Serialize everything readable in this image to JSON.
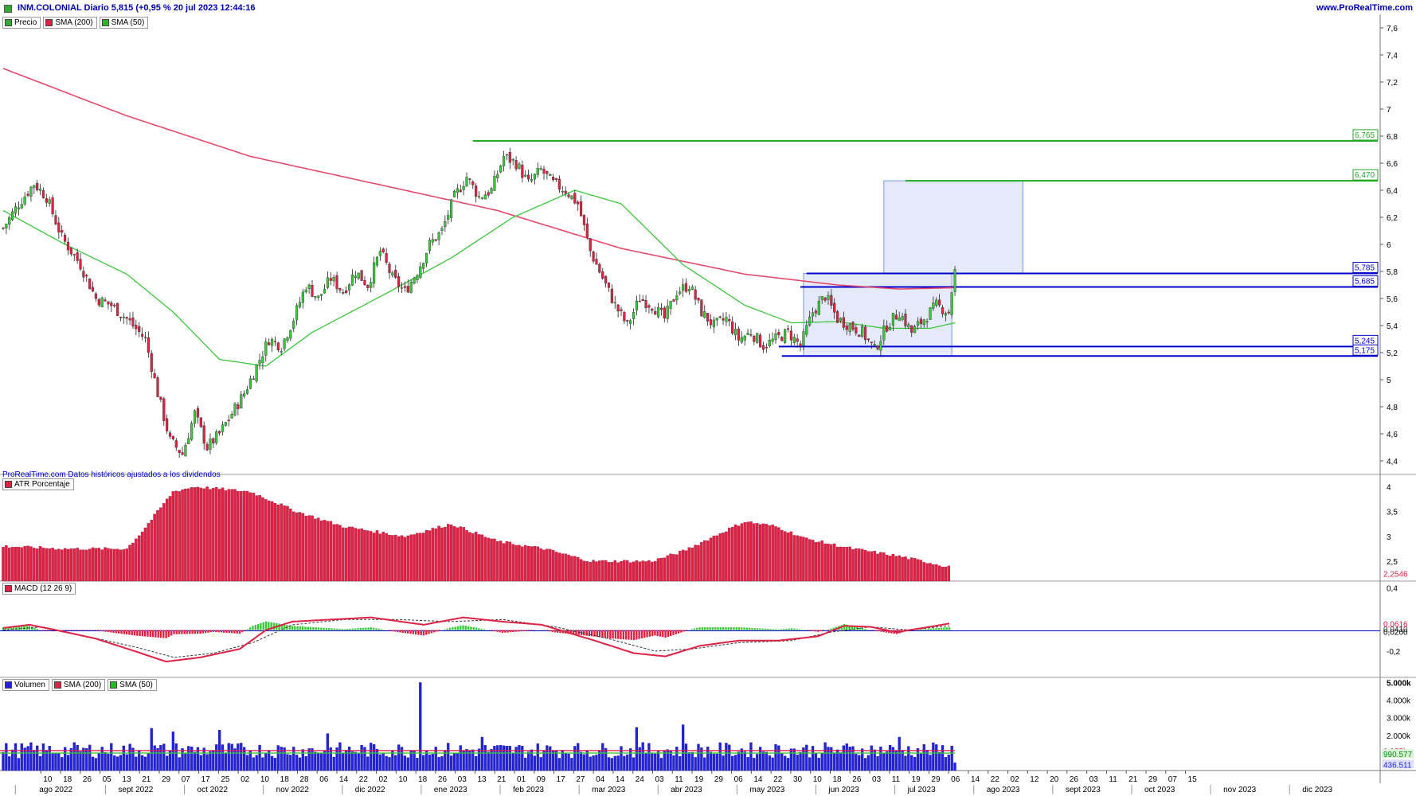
{
  "header": {
    "title": "INM.COLONIAL Diario 5,815 (+0,95 % 20 jul 2023 12:44:16",
    "site": "www.ProRealTime.com"
  },
  "note": "ProRealTime.com Datos históricos ajustados a los dividendos",
  "legends": {
    "price": [
      {
        "label": "Precio",
        "color": "#33aa33"
      },
      {
        "label": "SMA (200)",
        "color": "#dd2244"
      },
      {
        "label": "SMA (50)",
        "color": "#22bb22"
      }
    ],
    "atr": [
      {
        "label": "ATR Porcentaje",
        "color": "#dd2244"
      }
    ],
    "macd": [
      {
        "label": "MACD (12 26 9)",
        "color": "#dd2244"
      }
    ],
    "volume": [
      {
        "label": "Volumen",
        "color": "#2222dd"
      },
      {
        "label": "SMA (200)",
        "color": "#dd2244"
      },
      {
        "label": "SMA (50)",
        "color": "#22bb22"
      }
    ]
  },
  "chart_data": [
    {
      "type": "candlestick",
      "name": "Precio",
      "ylim": [
        4.3,
        7.7
      ],
      "yticks": [
        "7,6",
        "7,4",
        "7,2",
        "7",
        "6,8",
        "6,6",
        "6,4",
        "6,2",
        "6",
        "5,8",
        "5,6",
        "5,4",
        "5,2",
        "5",
        "4,8",
        "4,6",
        "4,4"
      ],
      "ytick_values": [
        7.6,
        7.4,
        7.2,
        7.0,
        6.8,
        6.6,
        6.4,
        6.2,
        6.0,
        5.8,
        5.6,
        5.4,
        5.2,
        5.0,
        4.8,
        4.6,
        4.4
      ],
      "last_close": 5.815,
      "close_anchors": [
        [
          0,
          6.12
        ],
        [
          5,
          6.3
        ],
        [
          10,
          6.45
        ],
        [
          14,
          6.35
        ],
        [
          19,
          6.05
        ],
        [
          25,
          5.85
        ],
        [
          30,
          5.6
        ],
        [
          35,
          5.55
        ],
        [
          40,
          5.45
        ],
        [
          46,
          5.3
        ],
        [
          50,
          4.9
        ],
        [
          54,
          4.55
        ],
        [
          58,
          4.45
        ],
        [
          62,
          4.75
        ],
        [
          66,
          4.5
        ],
        [
          70,
          4.6
        ],
        [
          74,
          4.75
        ],
        [
          78,
          4.9
        ],
        [
          82,
          5.1
        ],
        [
          86,
          5.3
        ],
        [
          90,
          5.25
        ],
        [
          94,
          5.45
        ],
        [
          98,
          5.7
        ],
        [
          102,
          5.6
        ],
        [
          106,
          5.75
        ],
        [
          110,
          5.65
        ],
        [
          114,
          5.8
        ],
        [
          118,
          5.7
        ],
        [
          122,
          5.95
        ],
        [
          126,
          5.75
        ],
        [
          130,
          5.65
        ],
        [
          134,
          5.8
        ],
        [
          138,
          6.0
        ],
        [
          142,
          6.1
        ],
        [
          146,
          6.35
        ],
        [
          150,
          6.5
        ],
        [
          154,
          6.35
        ],
        [
          158,
          6.4
        ],
        [
          162,
          6.65
        ],
        [
          166,
          6.6
        ],
        [
          170,
          6.45
        ],
        [
          174,
          6.55
        ],
        [
          178,
          6.45
        ],
        [
          182,
          6.4
        ],
        [
          186,
          6.3
        ],
        [
          190,
          5.95
        ],
        [
          194,
          5.75
        ],
        [
          198,
          5.55
        ],
        [
          202,
          5.4
        ],
        [
          206,
          5.6
        ],
        [
          210,
          5.55
        ],
        [
          214,
          5.45
        ],
        [
          218,
          5.65
        ],
        [
          222,
          5.7
        ],
        [
          226,
          5.5
        ],
        [
          230,
          5.4
        ],
        [
          234,
          5.45
        ],
        [
          238,
          5.3
        ],
        [
          242,
          5.35
        ],
        [
          246,
          5.25
        ],
        [
          250,
          5.3
        ],
        [
          254,
          5.35
        ],
        [
          258,
          5.25
        ],
        [
          262,
          5.5
        ],
        [
          266,
          5.62
        ],
        [
          270,
          5.45
        ],
        [
          274,
          5.4
        ],
        [
          278,
          5.35
        ],
        [
          282,
          5.22
        ],
        [
          286,
          5.4
        ],
        [
          290,
          5.5
        ],
        [
          294,
          5.35
        ],
        [
          298,
          5.45
        ],
        [
          302,
          5.55
        ],
        [
          306,
          5.5
        ],
        [
          308,
          5.815
        ]
      ],
      "sma200_anchors": [
        [
          0,
          7.3
        ],
        [
          40,
          6.95
        ],
        [
          80,
          6.65
        ],
        [
          120,
          6.45
        ],
        [
          160,
          6.25
        ],
        [
          200,
          5.97
        ],
        [
          240,
          5.78
        ],
        [
          270,
          5.7
        ],
        [
          290,
          5.67
        ],
        [
          308,
          5.68
        ]
      ],
      "sma50_anchors": [
        [
          0,
          6.25
        ],
        [
          20,
          6.0
        ],
        [
          40,
          5.78
        ],
        [
          55,
          5.5
        ],
        [
          70,
          5.15
        ],
        [
          85,
          5.1
        ],
        [
          100,
          5.35
        ],
        [
          125,
          5.65
        ],
        [
          145,
          5.9
        ],
        [
          165,
          6.2
        ],
        [
          185,
          6.4
        ],
        [
          200,
          6.3
        ],
        [
          220,
          5.85
        ],
        [
          240,
          5.55
        ],
        [
          255,
          5.42
        ],
        [
          270,
          5.43
        ],
        [
          285,
          5.38
        ],
        [
          300,
          5.38
        ],
        [
          308,
          5.42
        ]
      ],
      "levels": [
        {
          "label": "6,765",
          "value": 6.765,
          "color": "#22aa22"
        },
        {
          "label": "6,470",
          "value": 6.47,
          "color": "#22aa22"
        },
        {
          "label": "5,785",
          "value": 5.785,
          "color": "#0000cc"
        },
        {
          "label": "5,685",
          "value": 5.685,
          "color": "#0000cc"
        },
        {
          "label": "5,245",
          "value": 5.245,
          "color": "#0000cc"
        },
        {
          "label": "5,175",
          "value": 5.175,
          "color": "#0000cc"
        }
      ],
      "rectangles": [
        {
          "from_bar": 259,
          "to_bar": 307,
          "low": 5.175,
          "high": 5.785
        },
        {
          "from_bar": 285,
          "to_bar": 330,
          "low": 5.785,
          "high": 6.47
        }
      ]
    },
    {
      "type": "bar",
      "name": "ATR Porcentaje",
      "ylim": [
        2.1,
        4.2
      ],
      "yticks": [
        "4",
        "3,5",
        "3",
        "2,5"
      ],
      "ytick_values": [
        4,
        3.5,
        3,
        2.5
      ],
      "last_value_label": "2,2546",
      "last_value": 2.2546,
      "anchors": [
        [
          0,
          2.8
        ],
        [
          20,
          2.75
        ],
        [
          40,
          2.75
        ],
        [
          45,
          3.1
        ],
        [
          55,
          3.9
        ],
        [
          62,
          4.0
        ],
        [
          80,
          3.9
        ],
        [
          95,
          3.5
        ],
        [
          110,
          3.2
        ],
        [
          130,
          3.0
        ],
        [
          145,
          3.25
        ],
        [
          160,
          2.9
        ],
        [
          175,
          2.75
        ],
        [
          190,
          2.5
        ],
        [
          210,
          2.5
        ],
        [
          220,
          2.7
        ],
        [
          240,
          3.3
        ],
        [
          250,
          3.2
        ],
        [
          260,
          2.95
        ],
        [
          275,
          2.75
        ],
        [
          290,
          2.6
        ],
        [
          305,
          2.4
        ],
        [
          320,
          2.35
        ],
        [
          335,
          2.3
        ],
        [
          345,
          2.45
        ],
        [
          355,
          2.3
        ],
        [
          360,
          2.25
        ]
      ]
    },
    {
      "type": "line",
      "name": "MACD (12 26 9)",
      "ylim": [
        -0.45,
        0.45
      ],
      "yticks": [
        "0,4",
        "-0,2"
      ],
      "ytick_values": [
        0.4,
        -0.2
      ],
      "value_labels": [
        "0,0616",
        "0,0410",
        "0,0200"
      ],
      "macd_anchors": [
        [
          0,
          0.02
        ],
        [
          10,
          0.05
        ],
        [
          20,
          0.0
        ],
        [
          35,
          -0.08
        ],
        [
          50,
          -0.2
        ],
        [
          62,
          -0.3
        ],
        [
          75,
          -0.26
        ],
        [
          90,
          -0.18
        ],
        [
          100,
          0.0
        ],
        [
          110,
          0.08
        ],
        [
          125,
          0.1
        ],
        [
          140,
          0.12
        ],
        [
          160,
          0.05
        ],
        [
          175,
          0.12
        ],
        [
          190,
          0.08
        ],
        [
          205,
          0.05
        ],
        [
          225,
          -0.1
        ],
        [
          240,
          -0.22
        ],
        [
          252,
          -0.25
        ],
        [
          265,
          -0.15
        ],
        [
          280,
          -0.1
        ],
        [
          295,
          -0.1
        ],
        [
          310,
          -0.06
        ],
        [
          320,
          0.04
        ],
        [
          330,
          0.03
        ],
        [
          340,
          -0.02
        ],
        [
          350,
          0.02
        ],
        [
          360,
          0.062
        ]
      ],
      "signal_anchors": [
        [
          0,
          0.0
        ],
        [
          15,
          0.03
        ],
        [
          30,
          -0.05
        ],
        [
          50,
          -0.16
        ],
        [
          65,
          -0.26
        ],
        [
          80,
          -0.22
        ],
        [
          95,
          -0.12
        ],
        [
          110,
          0.05
        ],
        [
          130,
          0.1
        ],
        [
          150,
          0.1
        ],
        [
          170,
          0.08
        ],
        [
          190,
          0.1
        ],
        [
          210,
          0.03
        ],
        [
          230,
          -0.08
        ],
        [
          248,
          -0.2
        ],
        [
          262,
          -0.18
        ],
        [
          280,
          -0.12
        ],
        [
          300,
          -0.1
        ],
        [
          315,
          -0.02
        ],
        [
          330,
          0.03
        ],
        [
          345,
          0.0
        ],
        [
          360,
          0.041
        ]
      ]
    },
    {
      "type": "bar",
      "name": "Volumen",
      "ylim": [
        0,
        5200
      ],
      "yticks": [
        "5.000k",
        "4.000k",
        "3.000k",
        "2.000k"
      ],
      "ytick_values": [
        5000,
        4000,
        3000,
        2000
      ],
      "value_labels": [
        "1.133k",
        "990.577",
        "436.511"
      ],
      "sma200": 1133,
      "sma50": 990.577,
      "last_volume": 436.511,
      "spikes": [
        [
          48,
          2400
        ],
        [
          55,
          2200
        ],
        [
          70,
          2300
        ],
        [
          105,
          2100
        ],
        [
          135,
          5000
        ],
        [
          155,
          1900
        ],
        [
          205,
          2450
        ],
        [
          220,
          2600
        ],
        [
          290,
          1900
        ]
      ]
    }
  ],
  "xaxis": {
    "days": [
      {
        "bar": 10,
        "label": "10"
      },
      {
        "bar": 16,
        "label": "18"
      },
      {
        "bar": 22,
        "label": "26"
      },
      {
        "bar": 28,
        "label": "05"
      },
      {
        "bar": 34,
        "label": "13"
      },
      {
        "bar": 40,
        "label": "21"
      },
      {
        "bar": 46,
        "label": "29"
      },
      {
        "bar": 52,
        "label": "07"
      },
      {
        "bar": 58,
        "label": "17"
      },
      {
        "bar": 64,
        "label": "25"
      },
      {
        "bar": 70,
        "label": "02"
      },
      {
        "bar": 76,
        "label": "10"
      },
      {
        "bar": 82,
        "label": "18"
      },
      {
        "bar": 88,
        "label": "28"
      },
      {
        "bar": 94,
        "label": "06"
      },
      {
        "bar": 100,
        "label": "14"
      },
      {
        "bar": 106,
        "label": "22"
      },
      {
        "bar": 112,
        "label": "02"
      },
      {
        "bar": 118,
        "label": "10"
      },
      {
        "bar": 124,
        "label": "18"
      },
      {
        "bar": 130,
        "label": "26"
      },
      {
        "bar": 136,
        "label": "03"
      },
      {
        "bar": 142,
        "label": "13"
      },
      {
        "bar": 148,
        "label": "21"
      },
      {
        "bar": 154,
        "label": "01"
      },
      {
        "bar": 160,
        "label": "09"
      },
      {
        "bar": 166,
        "label": "17"
      },
      {
        "bar": 172,
        "label": "27"
      },
      {
        "bar": 178,
        "label": "04"
      },
      {
        "bar": 184,
        "label": "14"
      },
      {
        "bar": 190,
        "label": "24"
      },
      {
        "bar": 196,
        "label": "03"
      },
      {
        "bar": 202,
        "label": "11"
      },
      {
        "bar": 208,
        "label": "19"
      },
      {
        "bar": 214,
        "label": "29"
      },
      {
        "bar": 220,
        "label": "06"
      },
      {
        "bar": 226,
        "label": "14"
      },
      {
        "bar": 232,
        "label": "22"
      },
      {
        "bar": 238,
        "label": "30"
      },
      {
        "bar": 244,
        "label": "10"
      },
      {
        "bar": 250,
        "label": "18"
      },
      {
        "bar": 256,
        "label": "26"
      },
      {
        "bar": 262,
        "label": "03"
      },
      {
        "bar": 268,
        "label": "11"
      },
      {
        "bar": 274,
        "label": "19"
      },
      {
        "bar": 280,
        "label": "29"
      },
      {
        "bar": 286,
        "label": "06"
      },
      {
        "bar": 292,
        "label": "14"
      },
      {
        "bar": 298,
        "label": "22"
      },
      {
        "bar": 304,
        "label": "02"
      },
      {
        "bar": 310,
        "label": "12"
      },
      {
        "bar": 316,
        "label": "20"
      },
      {
        "bar": 322,
        "label": "26"
      },
      {
        "bar": 328,
        "label": "03"
      },
      {
        "bar": 334,
        "label": "11"
      },
      {
        "bar": 340,
        "label": "21"
      },
      {
        "bar": 346,
        "label": "29"
      },
      {
        "bar": 352,
        "label": "07"
      },
      {
        "bar": 358,
        "label": "15"
      }
    ],
    "months": [
      {
        "bar": 10,
        "label": "ago 2022"
      },
      {
        "bar": 34,
        "label": "sept 2022"
      },
      {
        "bar": 58,
        "label": "oct 2022"
      },
      {
        "bar": 82,
        "label": "nov 2022"
      },
      {
        "bar": 106,
        "label": "dic 2022"
      },
      {
        "bar": 130,
        "label": "ene 2023"
      },
      {
        "bar": 154,
        "label": "feb 2023"
      },
      {
        "bar": 178,
        "label": "mar 2023"
      },
      {
        "bar": 202,
        "label": "abr 2023"
      },
      {
        "bar": 226,
        "label": "may 2023"
      },
      {
        "bar": 250,
        "label": "jun 2023"
      },
      {
        "bar": 274,
        "label": "jul 2023"
      },
      {
        "bar": 298,
        "label": "ago 2023"
      },
      {
        "bar": 322,
        "label": "sept 2023"
      },
      {
        "bar": 346,
        "label": "oct 2023"
      },
      {
        "bar": 370,
        "label": "nov 2023"
      },
      {
        "bar": 394,
        "label": "dic 2023"
      }
    ]
  }
}
